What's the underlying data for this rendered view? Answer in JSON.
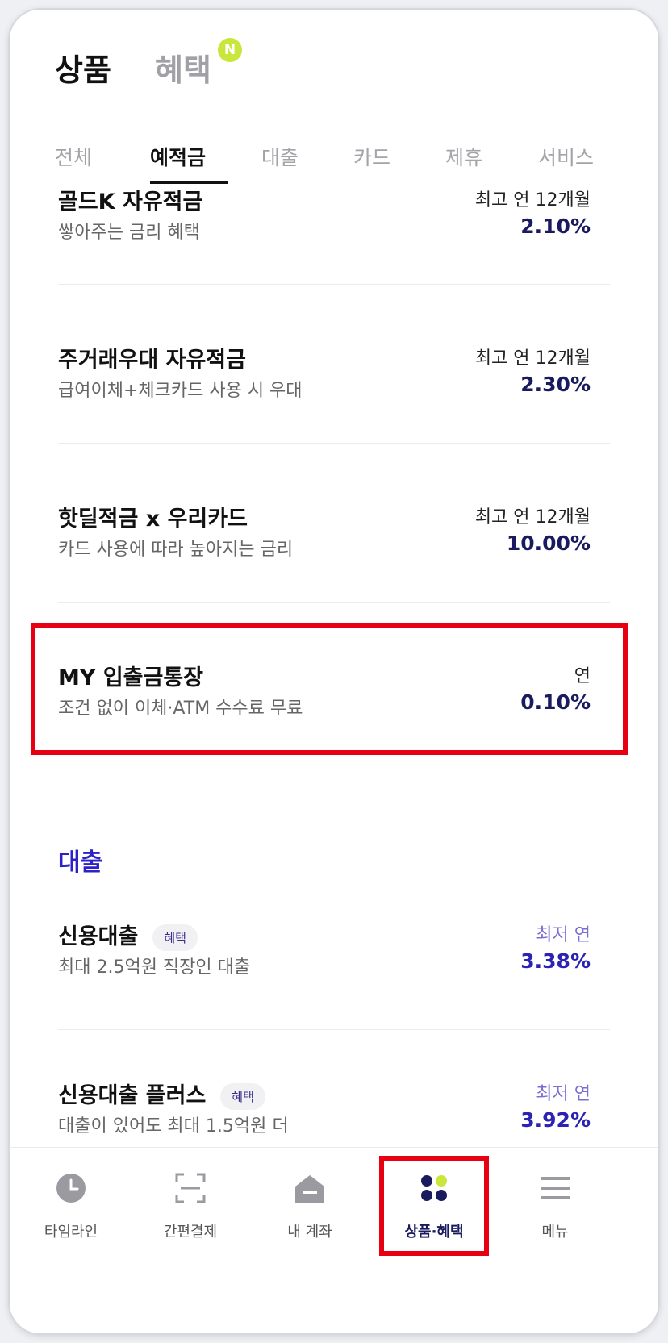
{
  "header": {
    "top_tabs": [
      {
        "label": "상품",
        "active": true
      },
      {
        "label": "혜택",
        "active": false
      }
    ],
    "new_badge": "N",
    "category_tabs": [
      {
        "label": "전체",
        "active": false
      },
      {
        "label": "예적금",
        "active": true
      },
      {
        "label": "대출",
        "active": false
      },
      {
        "label": "카드",
        "active": false
      },
      {
        "label": "제휴",
        "active": false
      },
      {
        "label": "서비스",
        "active": false
      }
    ]
  },
  "savings": [
    {
      "title": "골드K 자유적금",
      "desc": "쌓아주는 금리 혜택",
      "rate_label": "최고 연 12개월",
      "rate": "2.10%"
    },
    {
      "title": "주거래우대 자유적금",
      "desc": "급여이체+체크카드 사용 시 우대",
      "rate_label": "최고 연 12개월",
      "rate": "2.30%"
    },
    {
      "title": "핫딜적금 x 우리카드",
      "desc": "카드 사용에 따라 높아지는 금리",
      "rate_label": "최고 연 12개월",
      "rate": "10.00%"
    },
    {
      "title": "MY 입출금통장",
      "desc": "조건 없이 이체·ATM 수수료 무료",
      "rate_label": "연",
      "rate": "0.10%"
    }
  ],
  "loan_section": {
    "title": "대출",
    "items": [
      {
        "title": "신용대출",
        "badge": "혜택",
        "desc": "최대 2.5억원 직장인 대출",
        "rate_label": "최저 연",
        "rate": "3.38%"
      },
      {
        "title": "신용대출 플러스",
        "badge": "혜택",
        "desc": "대출이 있어도 최대 1.5억원 더",
        "rate_label": "최저 연",
        "rate": "3.92%"
      }
    ]
  },
  "bottom_nav": [
    {
      "label": "타임라인",
      "icon": "clock-icon",
      "active": false
    },
    {
      "label": "간편결제",
      "icon": "scan-icon",
      "active": false
    },
    {
      "label": "내 계좌",
      "icon": "home-account-icon",
      "active": false
    },
    {
      "label": "상품·혜택",
      "icon": "dots-grid-icon",
      "active": true
    },
    {
      "label": "메뉴",
      "icon": "hamburger-icon",
      "active": false
    }
  ],
  "colors": {
    "accent_navy": "#1a1a5e",
    "loan_blue": "#2c22c8",
    "highlight_red": "#e60012",
    "new_badge_green": "#c8e63c"
  }
}
